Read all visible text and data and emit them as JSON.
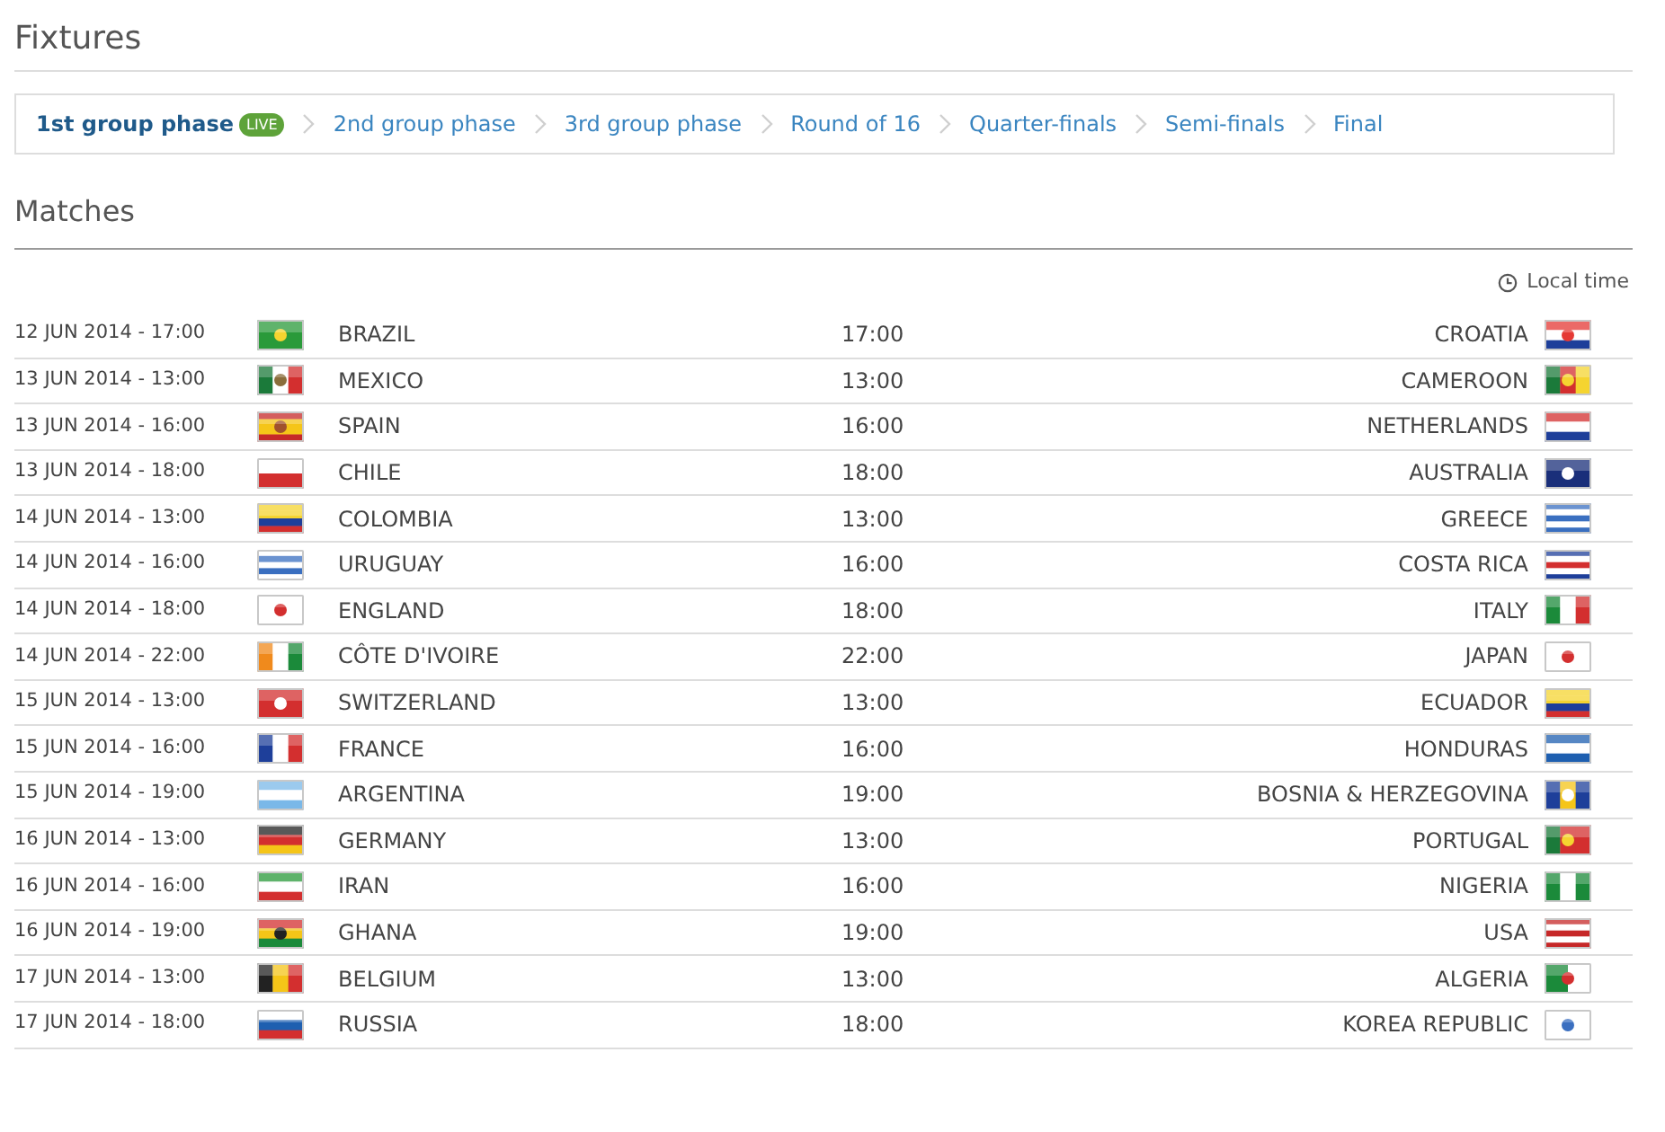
{
  "page_title": "Fixtures",
  "phases": [
    {
      "label": "1st group phase",
      "selected": true,
      "badge": "LIVE"
    },
    {
      "label": "2nd group phase",
      "selected": false
    },
    {
      "label": "3rd group phase",
      "selected": false
    },
    {
      "label": "Round of 16",
      "selected": false
    },
    {
      "label": "Quarter-finals",
      "selected": false
    },
    {
      "label": "Semi-finals",
      "selected": false
    },
    {
      "label": "Final",
      "selected": false
    }
  ],
  "section_title": "Matches",
  "time_note": "Local time",
  "matches": [
    {
      "date": "12 JUN 2014 - 17:00",
      "home": "BRAZIL",
      "time": "17:00",
      "away": "CROATIA"
    },
    {
      "date": "13 JUN 2014 - 13:00",
      "home": "MEXICO",
      "time": "13:00",
      "away": "CAMEROON"
    },
    {
      "date": "13 JUN 2014 - 16:00",
      "home": "SPAIN",
      "time": "16:00",
      "away": "NETHERLANDS"
    },
    {
      "date": "13 JUN 2014 - 18:00",
      "home": "CHILE",
      "time": "18:00",
      "away": "AUSTRALIA"
    },
    {
      "date": "14 JUN 2014 - 13:00",
      "home": "COLOMBIA",
      "time": "13:00",
      "away": "GREECE"
    },
    {
      "date": "14 JUN 2014 - 16:00",
      "home": "URUGUAY",
      "time": "16:00",
      "away": "COSTA RICA"
    },
    {
      "date": "14 JUN 2014 - 18:00",
      "home": "ENGLAND",
      "time": "18:00",
      "away": "ITALY"
    },
    {
      "date": "14 JUN 2014 - 22:00",
      "home": "CÔTE D'IVOIRE",
      "time": "22:00",
      "away": "JAPAN"
    },
    {
      "date": "15 JUN 2014 - 13:00",
      "home": "SWITZERLAND",
      "time": "13:00",
      "away": "ECUADOR"
    },
    {
      "date": "15 JUN 2014 - 16:00",
      "home": "FRANCE",
      "time": "16:00",
      "away": "HONDURAS"
    },
    {
      "date": "15 JUN 2014 - 19:00",
      "home": "ARGENTINA",
      "time": "19:00",
      "away": "BOSNIA & HERZEGOVINA"
    },
    {
      "date": "16 JUN 2014 - 13:00",
      "home": "GERMANY",
      "time": "13:00",
      "away": "PORTUGAL"
    },
    {
      "date": "16 JUN 2014 - 16:00",
      "home": "IRAN",
      "time": "16:00",
      "away": "NIGERIA"
    },
    {
      "date": "16 JUN 2014 - 19:00",
      "home": "GHANA",
      "time": "19:00",
      "away": "USA"
    },
    {
      "date": "17 JUN 2014 - 13:00",
      "home": "BELGIUM",
      "time": "13:00",
      "away": "ALGERIA"
    },
    {
      "date": "17 JUN 2014 - 18:00",
      "home": "RUSSIA",
      "time": "18:00",
      "away": "KOREA REPUBLIC"
    }
  ]
}
